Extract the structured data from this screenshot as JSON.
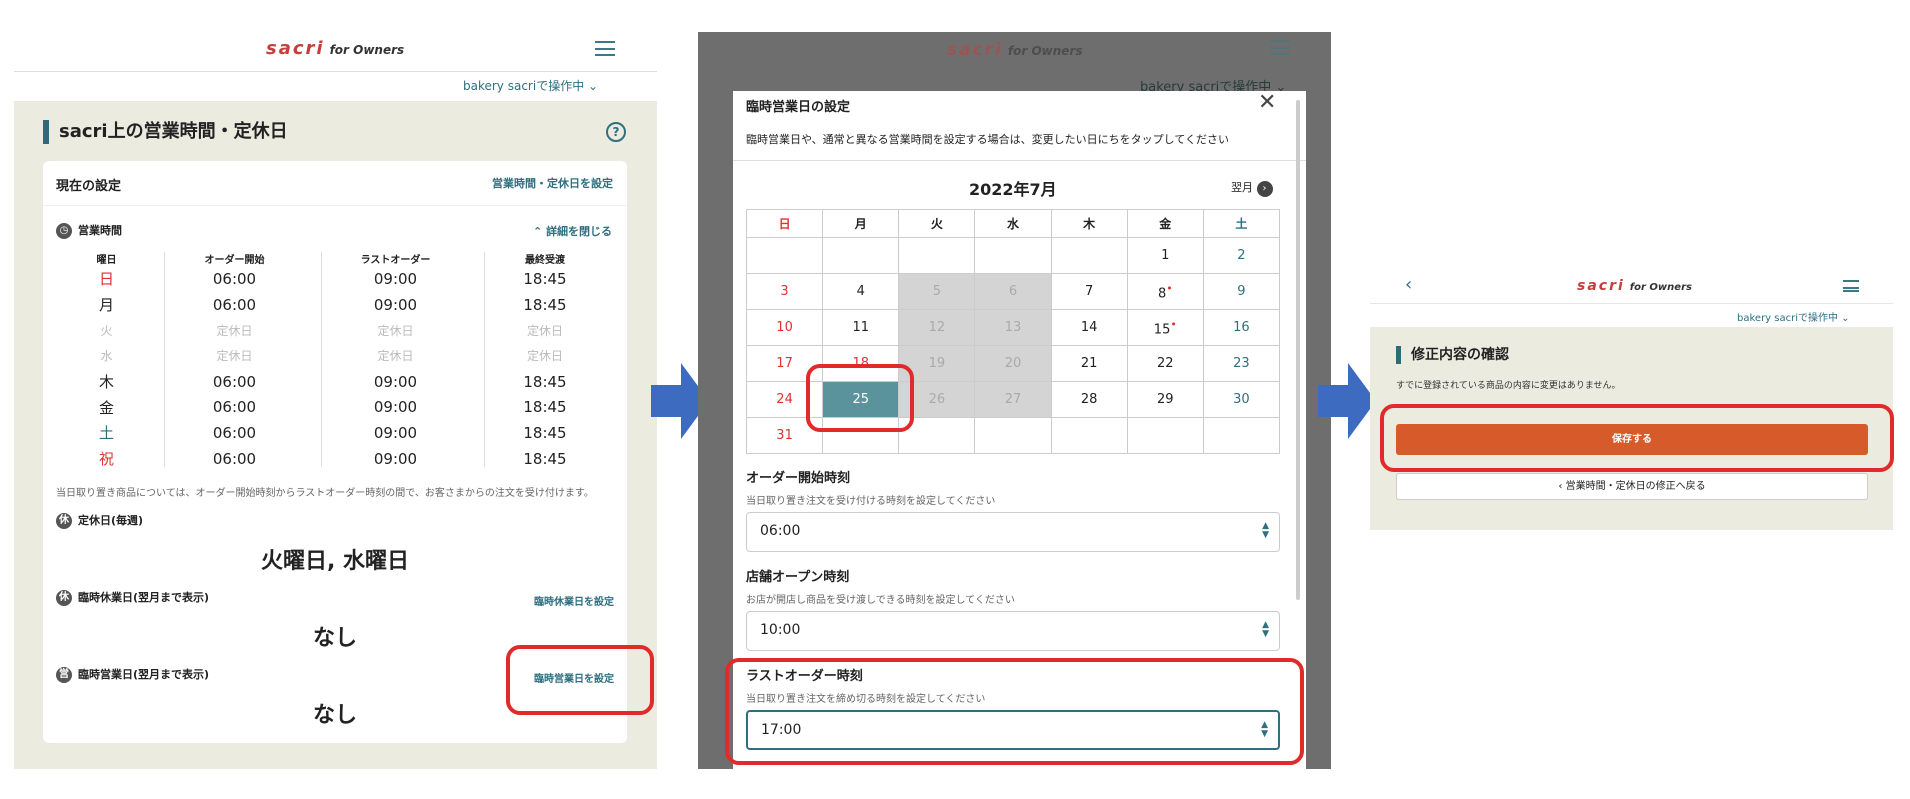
{
  "brand": {
    "name": "sacri",
    "suffix": "for Owners"
  },
  "panel1": {
    "store_switch": "bakery sacriで操作中",
    "section_title": "sacri上の営業時間・定休日",
    "current_settings": "現在の設定",
    "set_hours_link": "営業時間・定休日を設定",
    "hours_label": "営業時間",
    "collapse_link": "詳細を閉じる",
    "table_headers": [
      "曜日",
      "オーダー開始",
      "ラストオーダー",
      "最終受渡"
    ],
    "rows": [
      {
        "day": "日",
        "start": "06:00",
        "last": "09:00",
        "final": "18:45"
      },
      {
        "day": "月",
        "start": "06:00",
        "last": "09:00",
        "final": "18:45"
      },
      {
        "day": "火",
        "start": "定休日",
        "last": "定休日",
        "final": "定休日"
      },
      {
        "day": "水",
        "start": "定休日",
        "last": "定休日",
        "final": "定休日"
      },
      {
        "day": "木",
        "start": "06:00",
        "last": "09:00",
        "final": "18:45"
      },
      {
        "day": "金",
        "start": "06:00",
        "last": "09:00",
        "final": "18:45"
      },
      {
        "day": "土",
        "start": "06:00",
        "last": "09:00",
        "final": "18:45"
      },
      {
        "day": "祝",
        "start": "06:00",
        "last": "09:00",
        "final": "18:45"
      }
    ],
    "note": "当日取り置き商品については、オーダー開始時刻からラストオーダー時刻の間で、お客さまからの注文を受け付けます。",
    "weekly_holiday_label": "定休日(毎週)",
    "weekly_holiday_icon": "休",
    "weekly_holiday_value": "火曜日, 水曜日",
    "temp_closed_label": "臨時休業日(翌月まで表示)",
    "temp_closed_icon": "休",
    "temp_closed_link": "臨時休業日を設定",
    "temp_closed_value": "なし",
    "temp_open_label": "臨時営業日(翌月まで表示)",
    "temp_open_icon": "営",
    "temp_open_link": "臨時営業日を設定",
    "temp_open_value": "なし"
  },
  "panel2": {
    "store_switch": "bakery sacriで操作中",
    "modal_title": "臨時営業日の設定",
    "modal_desc": "臨時営業日や、通常と異なる営業時間を設定する場合は、変更したい日にちをタップしてください",
    "month": "2022年7月",
    "next_month": "翌月",
    "weekdays": [
      "日",
      "月",
      "火",
      "水",
      "木",
      "金",
      "土"
    ],
    "weeks": [
      [
        "",
        "",
        "",
        "",
        "",
        "1",
        "2"
      ],
      [
        "3",
        "4",
        "5",
        "6",
        "7",
        "8",
        "9"
      ],
      [
        "10",
        "11",
        "12",
        "13",
        "14",
        "15",
        "16"
      ],
      [
        "17",
        "18",
        "19",
        "20",
        "21",
        "22",
        "23"
      ],
      [
        "24",
        "25",
        "26",
        "27",
        "28",
        "29",
        "30"
      ],
      [
        "31",
        "",
        "",
        "",
        "",
        "",
        ""
      ]
    ],
    "order_start_label": "オーダー開始時刻",
    "order_start_hint": "当日取り置き注文を受け付ける時刻を設定してください",
    "order_start_value": "06:00",
    "open_label": "店舗オープン時刻",
    "open_hint": "お店が開店し商品を受け渡しできる時刻を設定してください",
    "open_value": "10:00",
    "last_order_label": "ラストオーダー時刻",
    "last_order_hint": "当日取り置き注文を締め切る時刻を設定してください",
    "last_order_value": "17:00"
  },
  "panel3": {
    "store_switch": "bakery sacriで操作中",
    "title": "修正内容の確認",
    "message": "すでに登録されている商品の内容に変更はありません。",
    "save_button": "保存する",
    "back_button": "営業時間・定休日の修正へ戻る"
  },
  "colors": {
    "accent": "#2f6f80",
    "brand_red": "#c2403c",
    "save": "#d75a2b",
    "highlight": "#e12b2b",
    "arrow": "#3d6bbf"
  }
}
